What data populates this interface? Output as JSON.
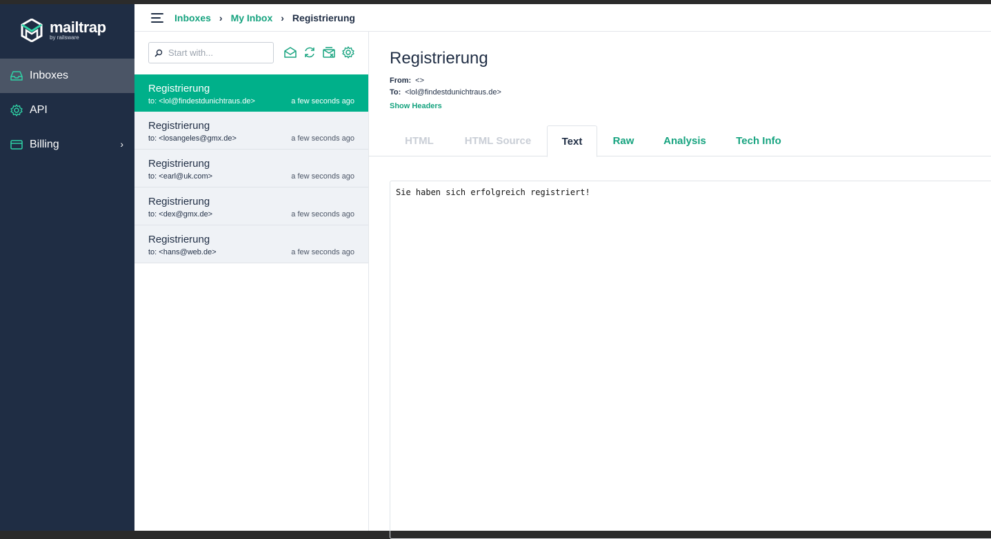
{
  "brand": {
    "name": "mailtrap",
    "sub": "by railsware"
  },
  "sidebar": {
    "items": [
      {
        "label": "Inboxes",
        "icon": "inbox-icon",
        "active": true
      },
      {
        "label": "API",
        "icon": "gear-icon",
        "active": false
      },
      {
        "label": "Billing",
        "icon": "credit-card-icon",
        "active": false,
        "arrow": "›"
      }
    ]
  },
  "breadcrumb": {
    "items": [
      "Inboxes",
      "My Inbox"
    ],
    "current": "Registrierung",
    "separator": "›"
  },
  "search": {
    "placeholder": "Start with...",
    "value": ""
  },
  "toolbar": {
    "icons": [
      "mark-read-icon",
      "refresh-icon",
      "clear-inbox-icon",
      "settings-icon"
    ]
  },
  "messages": [
    {
      "subject": "Registrierung",
      "to": "to: <lol@findestdunichtraus.de>",
      "time": "a few seconds ago",
      "selected": true
    },
    {
      "subject": "Registrierung",
      "to": "to: <losangeles@gmx.de>",
      "time": "a few seconds ago",
      "selected": false
    },
    {
      "subject": "Registrierung",
      "to": "to: <earl@uk.com>",
      "time": "a few seconds ago",
      "selected": false
    },
    {
      "subject": "Registrierung",
      "to": "to: <dex@gmx.de>",
      "time": "a few seconds ago",
      "selected": false
    },
    {
      "subject": "Registrierung",
      "to": "to: <hans@web.de>",
      "time": "a few seconds ago",
      "selected": false
    }
  ],
  "detail": {
    "title": "Registrierung",
    "from_label": "From:",
    "from_value": "<>",
    "to_label": "To:",
    "to_value": "<lol@findestdunichtraus.de>",
    "show_headers": "Show Headers",
    "tabs": [
      {
        "label": "HTML",
        "state": "disabled"
      },
      {
        "label": "HTML Source",
        "state": "disabled"
      },
      {
        "label": "Text",
        "state": "active"
      },
      {
        "label": "Raw",
        "state": "link"
      },
      {
        "label": "Analysis",
        "state": "link"
      },
      {
        "label": "Tech Info",
        "state": "link"
      }
    ],
    "body_text": "Sie haben sich erfolgreich registriert!"
  },
  "colors": {
    "accent": "#00b08a",
    "link": "#16a37f",
    "sidebar_bg": "#1f2d44",
    "sidebar_active": "#4b5566"
  }
}
